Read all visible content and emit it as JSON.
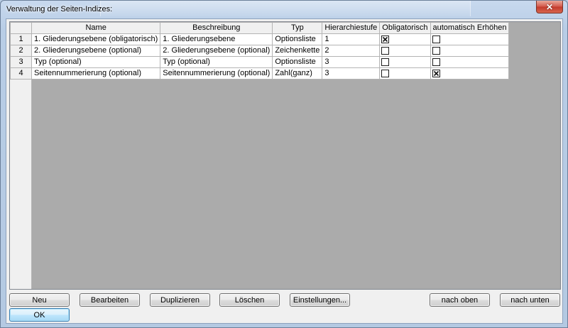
{
  "window": {
    "title": "Verwaltung der Seiten-Indizes:",
    "close_symbol": "✕"
  },
  "table": {
    "columns": [
      "Name",
      "Beschreibung",
      "Typ",
      "Hierarchiestufe",
      "Obligatorisch",
      "automatisch Erhöhen"
    ],
    "rows": [
      {
        "num": "1",
        "name": "1. Gliederungsebene (obligatorisch)",
        "beschreibung": "1. Gliederungsebene",
        "typ": "Optionsliste",
        "stufe": "1",
        "obligatorisch": true,
        "auto": false
      },
      {
        "num": "2",
        "name": "2. Gliederungsebene (optional)",
        "beschreibung": "2. Gliederungsebene (optional)",
        "typ": "Zeichenkette",
        "stufe": "2",
        "obligatorisch": false,
        "auto": false
      },
      {
        "num": "3",
        "name": "Typ (optional)",
        "beschreibung": "Typ (optional)",
        "typ": "Optionsliste",
        "stufe": "3",
        "obligatorisch": false,
        "auto": false
      },
      {
        "num": "4",
        "name": "Seitennummerierung (optional)",
        "beschreibung": "Seitennummerierung (optional)",
        "typ": "Zahl(ganz)",
        "stufe": "3",
        "obligatorisch": false,
        "auto": true
      }
    ]
  },
  "buttons": {
    "neu": "Neu",
    "bearbeiten": "Bearbeiten",
    "duplizieren": "Duplizieren",
    "loeschen": "Löschen",
    "einstellungen": "Einstellungen...",
    "nach_oben": "nach oben",
    "nach_unten": "nach unten",
    "ok": "OK"
  },
  "icons": {
    "checkbox_checked": "checkbox-checked-icon",
    "checkbox_unchecked": "checkbox-unchecked-icon",
    "close": "close-icon"
  }
}
